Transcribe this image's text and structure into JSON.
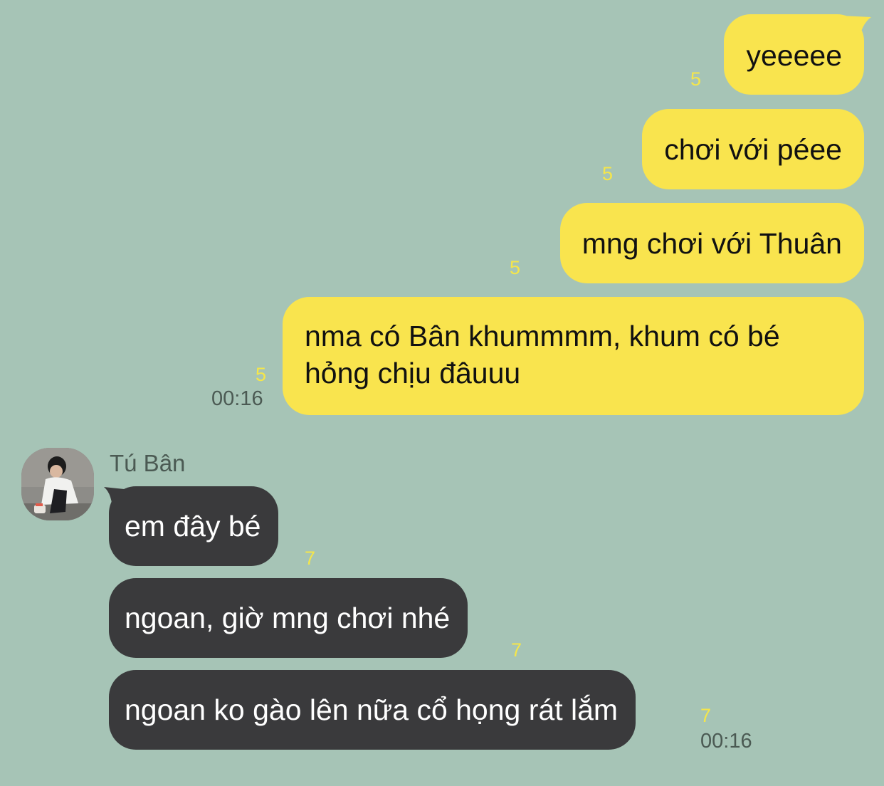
{
  "outgoing": [
    {
      "text": "yeeeee",
      "unread": "5"
    },
    {
      "text": "chơi với péee",
      "unread": "5"
    },
    {
      "text": "mng chơi với Thuân",
      "unread": "5"
    },
    {
      "text_line1": "nma có Bân khummmm, khum có bé",
      "text_line2": "hỏng chịu đâuuu",
      "unread": "5",
      "time": "00:16"
    }
  ],
  "incoming_group": {
    "sender_name": "Tú Bân",
    "avatar": "avatar-photo",
    "messages": [
      {
        "text": "em đây bé",
        "unread": "7"
      },
      {
        "text": "ngoan, giờ mng chơi nhé",
        "unread": "7"
      },
      {
        "text": "ngoan ko gào lên nữa cổ họng rát lắm",
        "unread": "7",
        "time": "00:16"
      }
    ]
  },
  "colors": {
    "background": "#a6c4b6",
    "outgoing_bubble": "#f9e44e",
    "incoming_bubble": "#3a3a3c",
    "unread_count": "#f5e64a",
    "timestamp": "#4b5a53"
  }
}
